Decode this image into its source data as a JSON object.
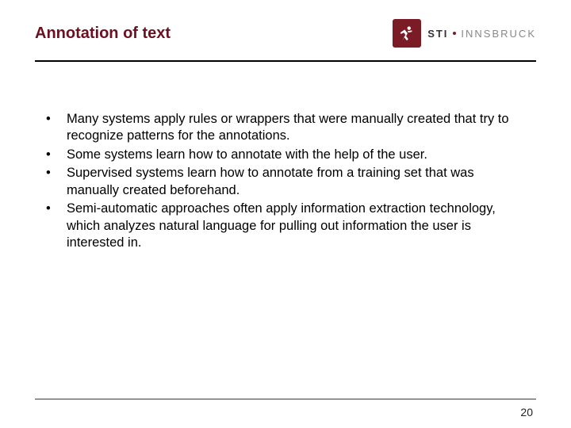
{
  "header": {
    "title": "Annotation of text",
    "logo": {
      "sti": "STI",
      "city": "INNSBRUCK"
    }
  },
  "bullets": [
    "Many systems apply rules or wrappers that were manually created that try to recognize patterns for the annotations.",
    "Some systems learn how to annotate with the help of the user.",
    "Supervised systems learn how to annotate from a training set that was manually created beforehand.",
    "Semi-automatic approaches often apply information extraction technology, which analyzes natural language for pulling out information the user is interested in."
  ],
  "page_number": "20"
}
